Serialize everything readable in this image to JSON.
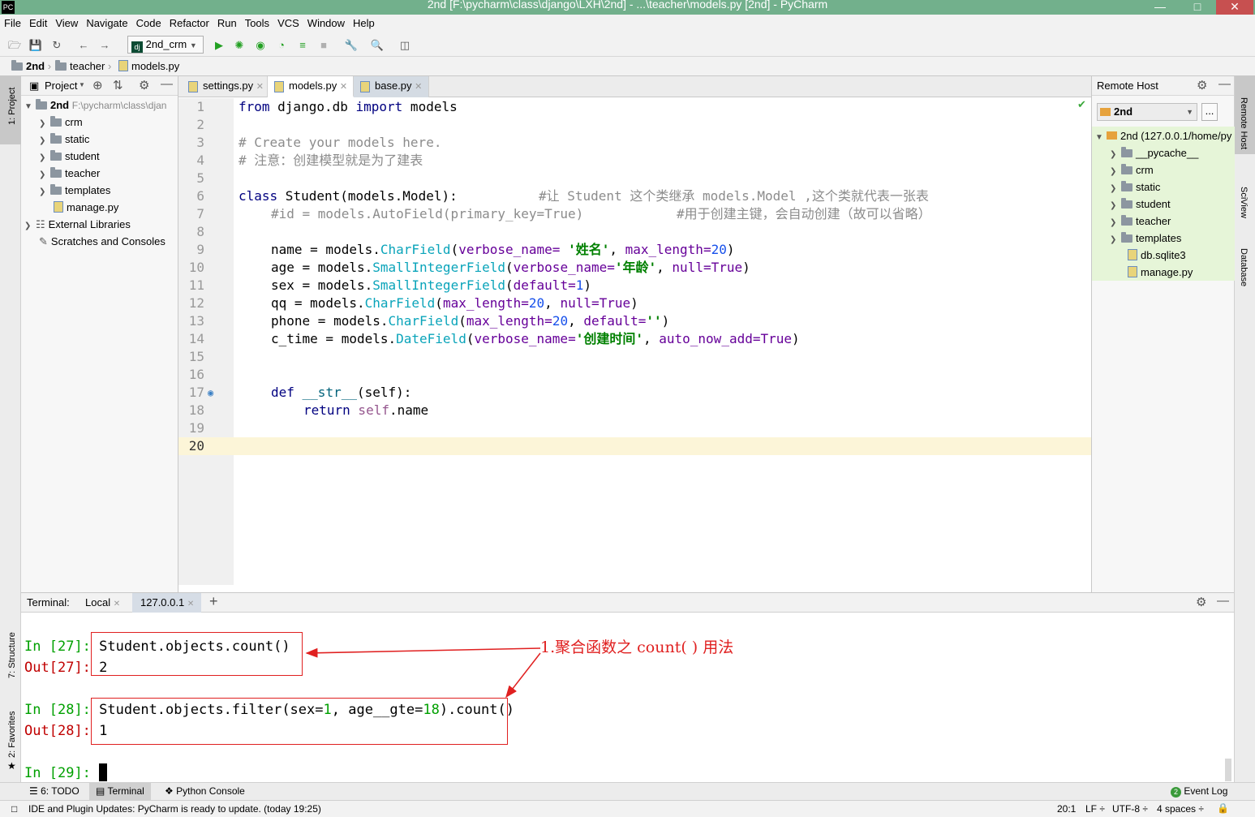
{
  "window": {
    "title": "2nd [F:\\pycharm\\class\\django\\LXH\\2nd] - ...\\teacher\\models.py [2nd] - PyCharm",
    "app_icon": "PC"
  },
  "menu": [
    "File",
    "Edit",
    "View",
    "Navigate",
    "Code",
    "Refactor",
    "Run",
    "Tools",
    "VCS",
    "Window",
    "Help"
  ],
  "toolbar": {
    "run_config": "2nd_crm"
  },
  "breadcrumb": [
    "2nd",
    "teacher",
    "models.py"
  ],
  "left_strip": {
    "project": "1: Project",
    "structure": "7: Structure",
    "favorites": "2: Favorites"
  },
  "right_strip": {
    "remote": "Remote Host",
    "sciview": "SciView",
    "database": "Database"
  },
  "project": {
    "header": "Project",
    "root_name": "2nd",
    "root_path": "F:\\pycharm\\class\\djan",
    "items": [
      {
        "label": "crm",
        "kind": "folder"
      },
      {
        "label": "static",
        "kind": "folder"
      },
      {
        "label": "student",
        "kind": "folder"
      },
      {
        "label": "teacher",
        "kind": "folder"
      },
      {
        "label": "templates",
        "kind": "folder"
      },
      {
        "label": "manage.py",
        "kind": "file"
      }
    ],
    "external": "External Libraries",
    "scratches": "Scratches and Consoles"
  },
  "tabs": [
    {
      "label": "settings.py",
      "active": false
    },
    {
      "label": "models.py",
      "active": true
    },
    {
      "label": "base.py",
      "active": false
    }
  ],
  "code": {
    "line_numbers": [
      "1",
      "2",
      "3",
      "4",
      "5",
      "6",
      "7",
      "8",
      "9",
      "10",
      "11",
      "12",
      "13",
      "14",
      "15",
      "16",
      "17",
      "18",
      "19",
      "20"
    ],
    "l1": {
      "a": "from",
      "b": " django.db ",
      "c": "import",
      "d": " models"
    },
    "l3": "# Create your models here.",
    "l4": "# 注意：创建模型就是为了建表",
    "l6": {
      "kw": "class",
      "name": " Student",
      "args": "(models.Model):",
      "comment": "#让 Student 这个类继承 models.Model ,这个类就代表一张表"
    },
    "l7": {
      "code": "#id = models.AutoField(primary_key=True)",
      "comment": "#用于创建主键，会自动创建（故可以省略）"
    },
    "l9": {
      "var": "name",
      "eq": " = models.",
      "fn": "CharField",
      "p1": "(",
      "k1": "verbose_name=",
      "s1": " '姓名'",
      "c1": ", ",
      "k2": "max_length=",
      "n2": "20",
      "end": ")"
    },
    "l10": {
      "var": "age",
      "eq": " = models.",
      "fn": "SmallIntegerField",
      "p1": "(",
      "k1": "verbose_name=",
      "s1": "'年龄'",
      "c1": ", ",
      "k2": "null=",
      "n2": "True",
      "end": ")"
    },
    "l11": {
      "var": "sex",
      "eq": " = models.",
      "fn": "SmallIntegerField",
      "p1": "(",
      "k1": "default=",
      "n1": "1",
      "end": ")"
    },
    "l12": {
      "var": "qq",
      "eq": " = models.",
      "fn": "CharField",
      "p1": "(",
      "k1": "max_length=",
      "n1": "20",
      "c1": ", ",
      "k2": "null=",
      "n2": "True",
      "end": ")"
    },
    "l13": {
      "var": "phone",
      "eq": " = models.",
      "fn": "CharField",
      "p1": "(",
      "k1": "max_length=",
      "n1": "20",
      "c1": ", ",
      "k2": "default=",
      "s2": "''",
      "end": ")"
    },
    "l14": {
      "var": "c_time",
      "eq": " = models.",
      "fn": "DateField",
      "p1": "(",
      "k1": "verbose_name=",
      "s1": "'创建时间'",
      "c1": ", ",
      "k2": "auto_now_add=",
      "n2": "True",
      "end": ")"
    },
    "l17": {
      "kw": "def",
      "name": " __str__",
      "args": "(self):"
    },
    "l18": {
      "kw": "return",
      "self": " self",
      "rest": ".name"
    }
  },
  "remote": {
    "header": "Remote Host",
    "server": "2nd",
    "browse": "...",
    "root": "2nd (127.0.0.1/home/py",
    "items": [
      {
        "label": "__pycache__",
        "kind": "folder"
      },
      {
        "label": "crm",
        "kind": "folder"
      },
      {
        "label": "static",
        "kind": "folder"
      },
      {
        "label": "student",
        "kind": "folder"
      },
      {
        "label": "teacher",
        "kind": "folder"
      },
      {
        "label": "templates",
        "kind": "folder"
      },
      {
        "label": "db.sqlite3",
        "kind": "file"
      },
      {
        "label": "manage.py",
        "kind": "file"
      }
    ]
  },
  "terminal": {
    "label": "Terminal:",
    "tabs": [
      "Local",
      "127.0.0.1"
    ],
    "add": "+",
    "lines": [
      {
        "prompt_a": "In [",
        "num": "27",
        "prompt_b": "]: ",
        "text": "Student.objects.count()"
      },
      {
        "prompt_a": "Out[",
        "num": "27",
        "prompt_b": "]: ",
        "text": "2"
      },
      {
        "prompt_a": "In [",
        "num": "28",
        "prompt_b": "]: ",
        "text_a": "Student.objects.filter(sex=",
        "n1": "1",
        "text_b": ", age__gte=",
        "n2": "18",
        "text_c": ").count()"
      },
      {
        "prompt_a": "Out[",
        "num": "28",
        "prompt_b": "]: ",
        "text": "1"
      },
      {
        "prompt_a": "In [",
        "num": "29",
        "prompt_b": "]: "
      }
    ],
    "annotation": "1.聚合函数之 count( ) 用法"
  },
  "bottom_tabs": [
    "6: TODO",
    "Terminal",
    "Python Console"
  ],
  "event_log": {
    "count": "2",
    "label": "Event Log"
  },
  "status": {
    "message": "IDE and Plugin Updates: PyCharm is ready to update. (today 19:25)",
    "position": "20:1",
    "line_sep": "LF ÷",
    "encoding": "UTF-8 ÷",
    "indent": "4 spaces ÷"
  },
  "colors": {
    "accent_green": "#00a000",
    "annotation_red": "#e02020",
    "current_line": "#fcf5d8"
  }
}
